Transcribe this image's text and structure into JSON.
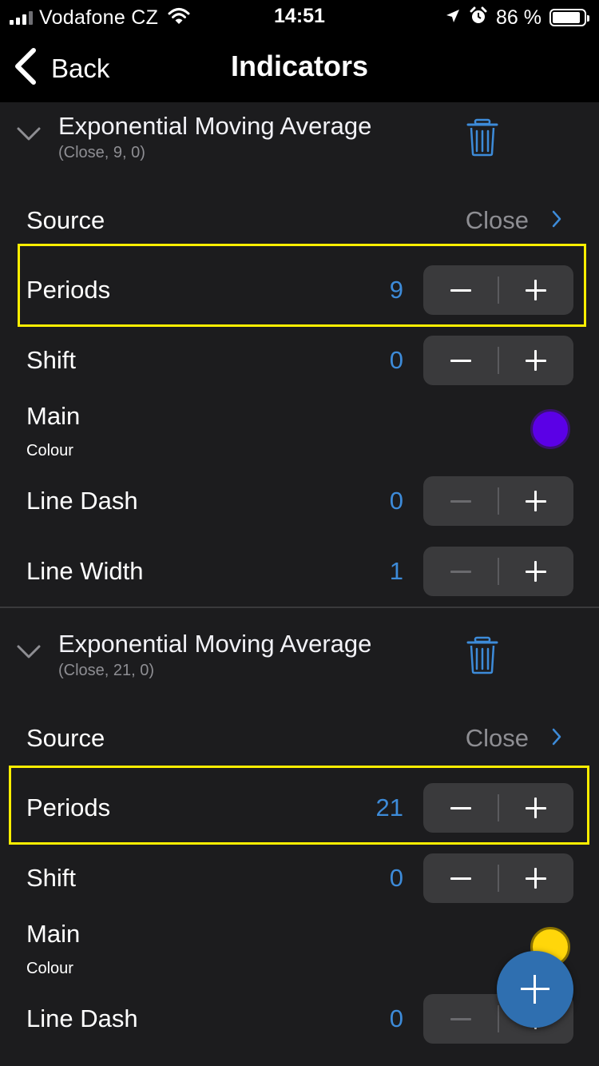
{
  "status_bar": {
    "carrier": "Vodafone CZ",
    "time": "14:51",
    "battery": "86 %",
    "icons": [
      "signal-icon",
      "wifi-icon",
      "location-arrow-icon",
      "alarm-icon",
      "battery-icon"
    ]
  },
  "nav": {
    "back_label": "Back",
    "title": "Indicators"
  },
  "colors": {
    "accent": "#3d8bd9",
    "highlight": "#ffee00",
    "fab": "#2f6fb0"
  },
  "indicators": [
    {
      "title": "Exponential Moving Average",
      "subtitle": "(Close, 9, 0)",
      "source_label": "Source",
      "source_value": "Close",
      "periods_label": "Periods",
      "periods_value": "9",
      "shift_label": "Shift",
      "shift_value": "0",
      "main_label": "Main",
      "main_sub": "Colour",
      "main_color": "#5b00e6",
      "line_dash_label": "Line Dash",
      "line_dash_value": "0",
      "line_width_label": "Line Width",
      "line_width_value": "1"
    },
    {
      "title": "Exponential Moving Average",
      "subtitle": "(Close, 21, 0)",
      "source_label": "Source",
      "source_value": "Close",
      "periods_label": "Periods",
      "periods_value": "21",
      "shift_label": "Shift",
      "shift_value": "0",
      "main_label": "Main",
      "main_sub": "Colour",
      "main_color": "#ffd60a",
      "line_dash_label": "Line Dash",
      "line_dash_value": "0"
    }
  ]
}
